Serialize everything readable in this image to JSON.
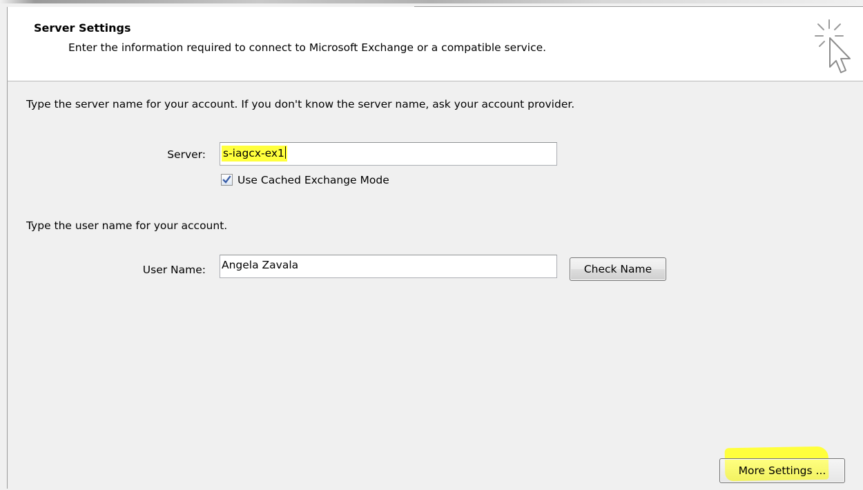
{
  "header": {
    "title": "Server Settings",
    "subtitle": "Enter the information required to connect to Microsoft Exchange or a compatible service.",
    "icon": "wizard-cursor-icon"
  },
  "server_section": {
    "intro": "Type the server name for your account. If you don't know the server name, ask your account provider.",
    "server_label": "Server:",
    "server_value": "s-iagcx-ex1",
    "cached_mode_label": "Use Cached Exchange Mode",
    "cached_mode_checked": true
  },
  "user_section": {
    "intro": "Type the user name for your account.",
    "user_label": "User Name:",
    "user_value": "Angela Zavala",
    "check_name_button": "Check Name"
  },
  "footer": {
    "more_settings_button": "More Settings ..."
  },
  "colors": {
    "highlight": "#ffff3c",
    "header_bg": "#ffffff",
    "dialog_bg": "#f0f0f0",
    "checkmark": "#3b5fa8"
  }
}
